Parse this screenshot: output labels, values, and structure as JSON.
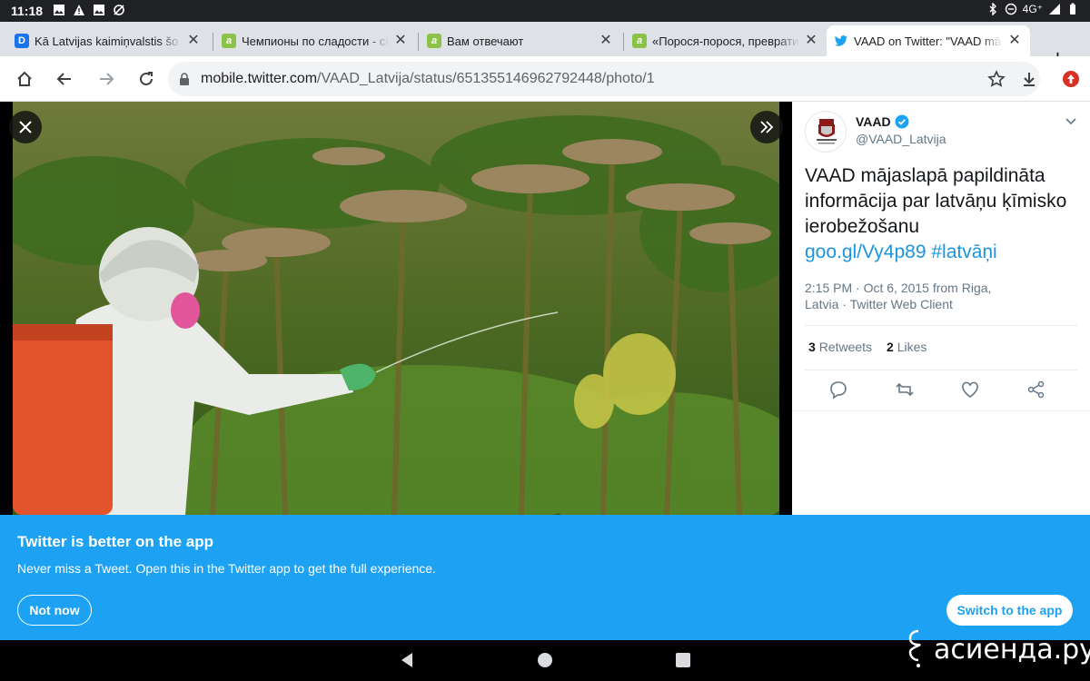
{
  "status_bar": {
    "time": "11:18",
    "network": "4G⁺"
  },
  "tabs": [
    {
      "title": "Kā Latvijas kaimiņvalstis šo",
      "favicon": "delfi-icon",
      "favicon_color": "#1a73e8",
      "favicon_letter": "D"
    },
    {
      "title": "Чемпионы по сладости - се",
      "favicon": "acienda-icon",
      "favicon_color": "#8bc34a",
      "favicon_letter": "a"
    },
    {
      "title": "Вам отвечают",
      "favicon": "acienda-icon",
      "favicon_color": "#8bc34a",
      "favicon_letter": "a"
    },
    {
      "title": "«Порося-порося, преврати",
      "favicon": "acienda-icon",
      "favicon_color": "#8bc34a",
      "favicon_letter": "a"
    },
    {
      "title": "VAAD on Twitter: \"VAAD mā",
      "favicon": "twitter-icon",
      "favicon_color": "#1da1f2",
      "favicon_letter": ""
    }
  ],
  "omnibox": {
    "host": "mobile.twitter.com",
    "path": "/VAAD_Latvija/status/651355146962792448/photo/1"
  },
  "tweet": {
    "author_name": "VAAD",
    "author_handle": "@VAAD_Latvija",
    "text": "VAAD mājaslapā papildināta informācija par latvāņu ķīmisko ierobežošanu",
    "link": "goo.gl/Vy4p89",
    "hashtag": "#latvāņi",
    "time": "2:15 PM · Oct 6, 2015 from Riga,",
    "location_rest": "Latvia",
    "source": "Twitter Web Client",
    "retweets_count": "3",
    "retweets_label": "Retweets",
    "likes_count": "2",
    "likes_label": "Likes"
  },
  "banner": {
    "title": "Twitter is better on the app",
    "subtitle": "Never miss a Tweet. Open this in the Twitter app to get the full experience.",
    "not_now": "Not now",
    "switch": "Switch to the app"
  },
  "watermark": {
    "text": "асиенда.ру"
  },
  "colors": {
    "twitter_blue": "#1da1f2",
    "link_blue": "#1b95e0",
    "verified_blue": "#1da1f2"
  }
}
